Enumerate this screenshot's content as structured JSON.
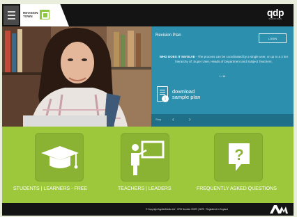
{
  "header": {
    "logo_text": "REVISION TOWN",
    "brand_name": "qdp",
    "brand_sub": "SERVICES"
  },
  "hero": {
    "panel_title": "Revision Plan",
    "login_label": "LOGIN",
    "involve_heading": "WHO DOES IT INVOLVE",
    "involve_text": " - The process can be coordinated by a single user, or up to a 3 tier hierarchy of: Super User, Heads of Department and Subject Teachers.",
    "tiny_label": "1 / 16",
    "download_line1": "download",
    "download_line2": "sample plan",
    "nav_stop": "Stop"
  },
  "tiles": [
    {
      "label": "STUDENTS | LEARNERS - FREE",
      "icon": "graduation-cap-icon"
    },
    {
      "label": "TEACHERS | LEADERS",
      "icon": "teacher-board-icon"
    },
    {
      "label": "FREQUENTLY ASKED QUESTIONS",
      "icon": "question-mark-icon"
    }
  ],
  "footer": {
    "copyright": "© Copyright AppliedMedia Ltd · CRO Number 09679 | 5675 · Registered in England",
    "logo": "AM"
  },
  "colors": {
    "accent_green": "#9dc83c",
    "panel_blue": "#2d8fae",
    "dark": "#141414"
  }
}
